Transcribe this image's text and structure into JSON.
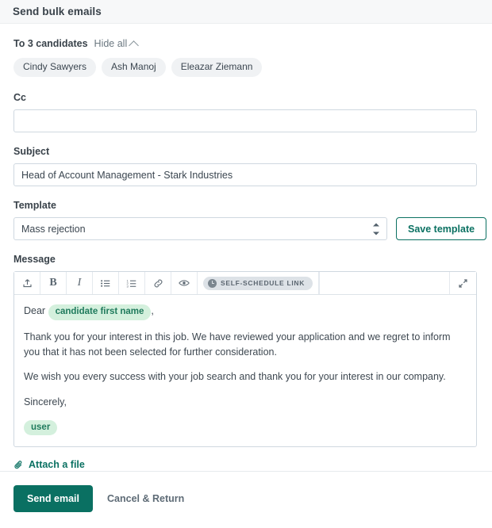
{
  "header": {
    "title": "Send bulk emails"
  },
  "recipients": {
    "count_label": "To 3 candidates",
    "toggle_label": "Hide all",
    "toggle_icon": "chevron-up-icon",
    "chips": [
      "Cindy Sawyers",
      "Ash Manoj",
      "Eleazar Ziemann"
    ]
  },
  "cc": {
    "label": "Cc",
    "value": "",
    "placeholder": ""
  },
  "subject": {
    "label": "Subject",
    "value": "Head of Account Management - Stark Industries",
    "placeholder": ""
  },
  "template": {
    "label": "Template",
    "selected": "Mass rejection",
    "options": [
      "Mass rejection"
    ],
    "save_label": "Save template"
  },
  "message": {
    "label": "Message",
    "toolbar": {
      "buttons": [
        {
          "name": "upload-icon",
          "glyph": "upload"
        },
        {
          "name": "bold-icon",
          "glyph": "B"
        },
        {
          "name": "italic-icon",
          "glyph": "I"
        },
        {
          "name": "bulleted-list-icon",
          "glyph": "ul"
        },
        {
          "name": "numbered-list-icon",
          "glyph": "ol"
        },
        {
          "name": "link-icon",
          "glyph": "link"
        },
        {
          "name": "preview-eye-icon",
          "glyph": "eye"
        }
      ],
      "self_schedule_label": "SELF-SCHEDULE LINK",
      "self_schedule_icon": "clock-icon",
      "expand_icon": "expand-icon"
    },
    "greeting_prefix": "Dear",
    "greeting_token": "candidate first name",
    "greeting_suffix": ",",
    "paragraph_1": "Thank you for your interest in this job. We have reviewed your application and we regret to inform you that it has not been selected for further consideration.",
    "paragraph_2": "We wish you every success with your job search and thank you for your interest in our company.",
    "signoff": "Sincerely,",
    "signature_token": "user"
  },
  "attach": {
    "label": "Attach a file",
    "icon": "paperclip-icon"
  },
  "footer": {
    "send_label": "Send email",
    "cancel_label": "Cancel & Return"
  },
  "colors": {
    "primary": "#0a7062",
    "outline": "#0b7162",
    "token_bg": "#d4f0dd",
    "token_text": "#1f7a5c",
    "chip_bg": "#f0f2f4",
    "header_bg": "#f7f8f9"
  }
}
